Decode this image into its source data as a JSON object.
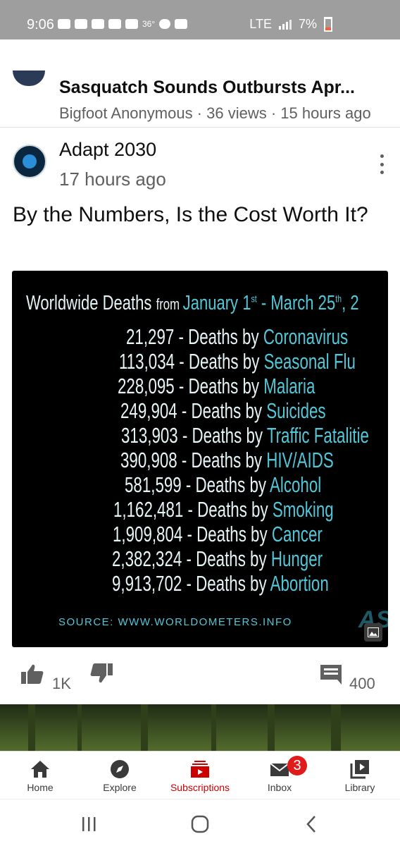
{
  "status_bar": {
    "time": "9:06",
    "temp": "36°",
    "network": "LTE",
    "battery": "7%"
  },
  "previous_video": {
    "title": "Sasquatch Sounds Outbursts Apr...",
    "meta": "Bigfoot Anonymous · 36 views · 15 hours ago"
  },
  "post": {
    "author": "Adapt 2030",
    "time_ago": "17 hours ago",
    "text": "By the Numbers, Is the Cost Worth It?",
    "likes": "1K",
    "comments": "400",
    "image": {
      "title_a": "Worldwide Deaths ",
      "title_b": "from ",
      "title_c": "January 1",
      "title_st": "st",
      "title_d": " - March 25",
      "title_th": "th",
      "title_e": ", 2",
      "rows": [
        {
          "count": "21,297",
          "sep": " - Deaths by ",
          "cause": "Coronavirus"
        },
        {
          "count": "113,034",
          "sep": " - Deaths by ",
          "cause": "Seasonal Flu"
        },
        {
          "count": "228,095",
          "sep": " - Deaths by ",
          "cause": "Malaria"
        },
        {
          "count": "249,904",
          "sep": " - Deaths by ",
          "cause": "Suicides"
        },
        {
          "count": "313,903",
          "sep": " - Deaths by ",
          "cause": "Traffic Fatalitie"
        },
        {
          "count": "390,908",
          "sep": " - Deaths by ",
          "cause": "HIV/AIDS"
        },
        {
          "count": "581,599",
          "sep": " - Deaths by ",
          "cause": "Alcohol"
        },
        {
          "count": "1,162,481",
          "sep": " - Deaths by ",
          "cause": "Smoking"
        },
        {
          "count": "1,909,804",
          "sep": " - Deaths by ",
          "cause": "Cancer"
        },
        {
          "count": "2,382,324",
          "sep": " - Deaths by ",
          "cause": "Hunger"
        },
        {
          "count": "9,913,702",
          "sep": " - Deaths by ",
          "cause": "Abortion"
        }
      ],
      "source": "SOURCE: WWW.WORLDOMETERS.INFO",
      "logo": "AS"
    }
  },
  "bottom_nav": {
    "home": "Home",
    "explore": "Explore",
    "subscriptions": "Subscriptions",
    "inbox": "Inbox",
    "inbox_badge": "3",
    "library": "Library"
  }
}
